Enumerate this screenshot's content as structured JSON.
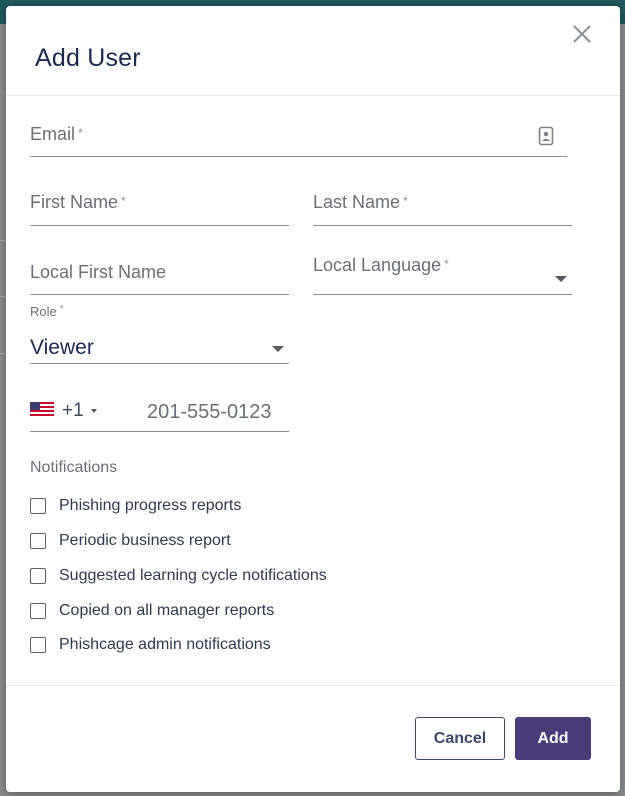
{
  "dialog": {
    "title": "Add User",
    "close_icon": "close-icon"
  },
  "form": {
    "email": {
      "label": "Email",
      "required": "*",
      "icon": "contact-card-icon"
    },
    "first_name": {
      "label": "First Name",
      "required": "*"
    },
    "last_name": {
      "label": "Last Name",
      "required": "*"
    },
    "local_first_name": {
      "label": "Local First Name"
    },
    "local_language": {
      "label": "Local Language",
      "required": "*"
    },
    "role": {
      "label": "Role",
      "required": "*",
      "value": "Viewer"
    },
    "phone": {
      "flag_icon": "us-flag-icon",
      "dial_code": "+1",
      "placeholder": "201-555-0123"
    }
  },
  "notifications": {
    "label": "Notifications",
    "items": [
      {
        "label": "Phishing progress reports",
        "checked": false
      },
      {
        "label": "Periodic business report",
        "checked": false
      },
      {
        "label": "Suggested learning cycle notifications",
        "checked": false
      },
      {
        "label": "Copied on all manager reports",
        "checked": false
      },
      {
        "label": "Phishcage admin notifications",
        "checked": false
      }
    ]
  },
  "actions": {
    "cancel_label": "Cancel",
    "add_label": "Add"
  },
  "colors": {
    "title": "#1e2a52",
    "primary_button": "#4a3b78",
    "secondary_border": "#3b4a6b",
    "header_bar": "#1f5a5a"
  }
}
